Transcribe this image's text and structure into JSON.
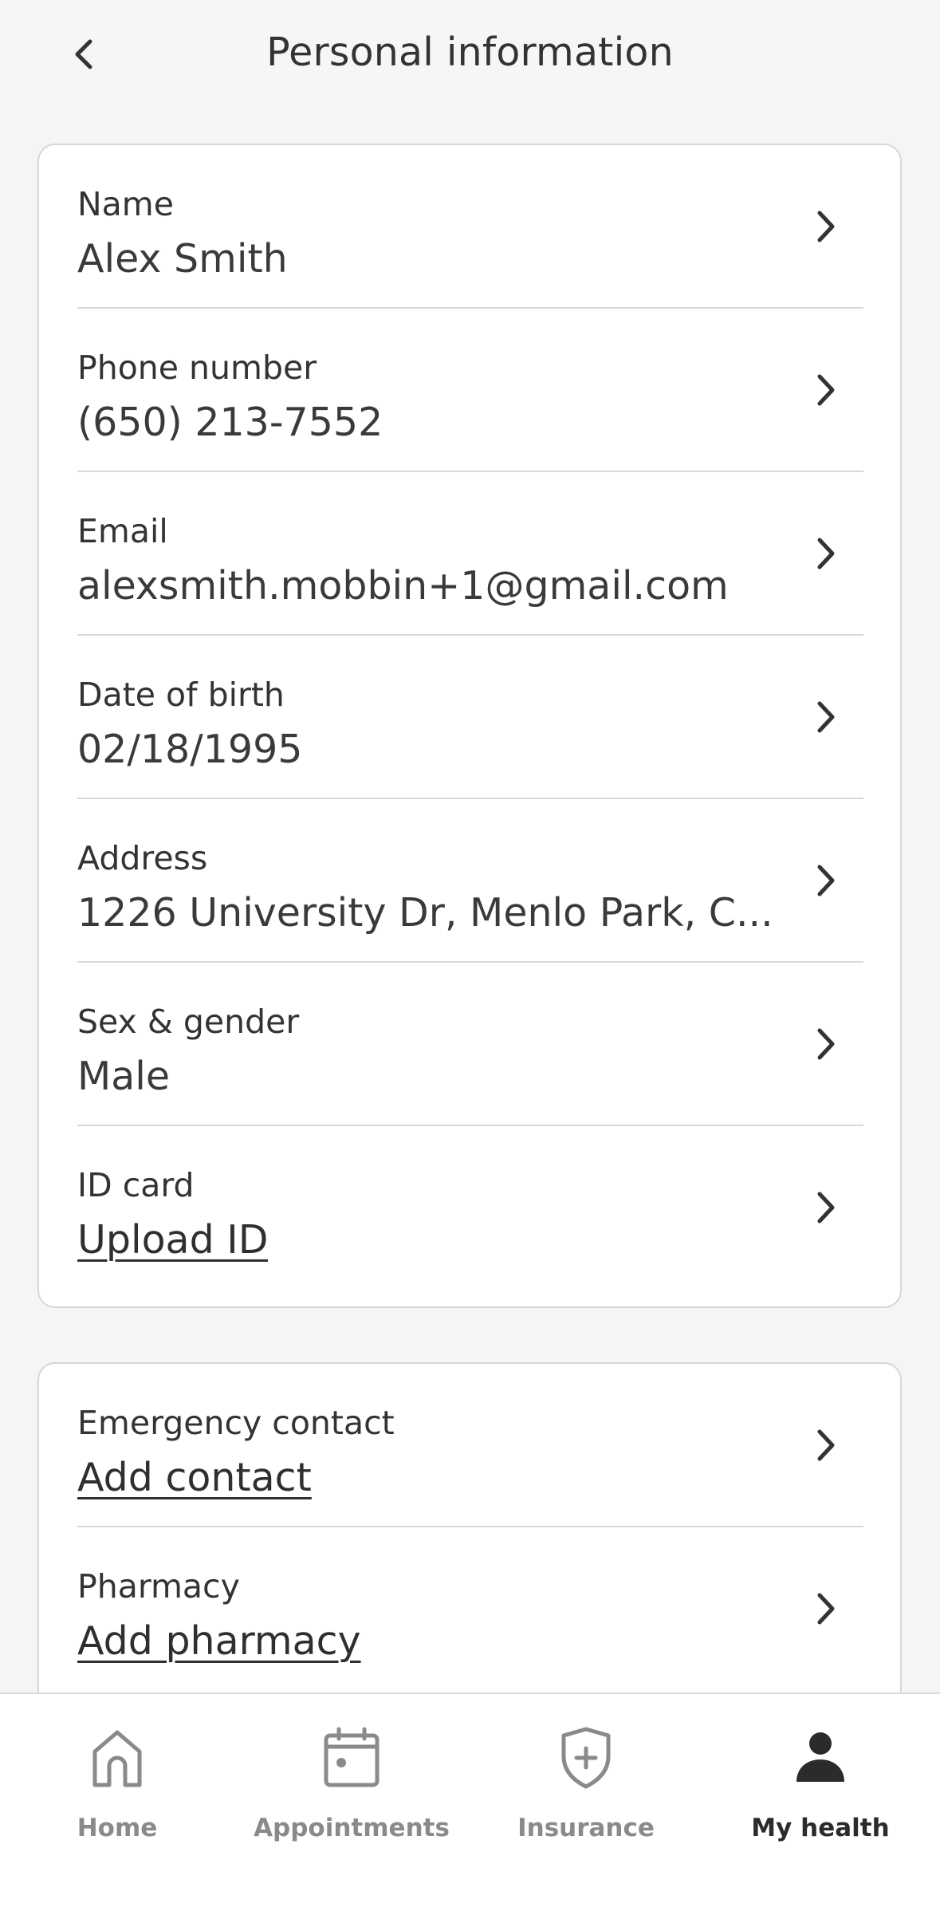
{
  "header": {
    "title": "Personal information",
    "back_icon": "chevron-left-icon"
  },
  "personal_card": {
    "rows": [
      {
        "label": "Name",
        "value": "Alex Smith",
        "is_link": false
      },
      {
        "label": "Phone number",
        "value": "(650) 213-7552",
        "is_link": false
      },
      {
        "label": "Email",
        "value": "alexsmith.mobbin+1@gmail.com",
        "is_link": false
      },
      {
        "label": "Date of birth",
        "value": "02/18/1995",
        "is_link": false
      },
      {
        "label": "Address",
        "value": "1226 University Dr, Menlo Park, C...",
        "is_link": false
      },
      {
        "label": "Sex & gender",
        "value": "Male",
        "is_link": false
      },
      {
        "label": "ID card",
        "value": "Upload ID",
        "is_link": true
      }
    ]
  },
  "contacts_card": {
    "rows": [
      {
        "label": "Emergency contact",
        "value": "Add contact",
        "is_link": true
      },
      {
        "label": "Pharmacy",
        "value": "Add pharmacy",
        "is_link": true
      }
    ]
  },
  "tabbar": {
    "tabs": [
      {
        "label": "Home",
        "icon": "home-icon",
        "active": false
      },
      {
        "label": "Appointments",
        "icon": "calendar-icon",
        "active": false
      },
      {
        "label": "Insurance",
        "icon": "shield-plus-icon",
        "active": false
      },
      {
        "label": "My health",
        "icon": "person-icon",
        "active": true
      }
    ]
  },
  "colors": {
    "background": "#f5f5f5",
    "card": "#ffffff",
    "text": "#333333",
    "inactive_tab": "#8a8a8a",
    "active_tab": "#2b2b2b"
  }
}
